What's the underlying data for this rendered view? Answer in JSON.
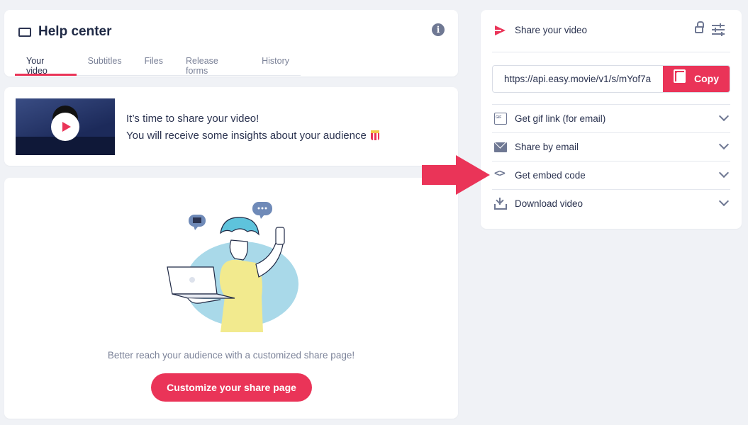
{
  "header": {
    "title": "Help center",
    "tabs": [
      {
        "label": "Your video",
        "active": true
      },
      {
        "label": "Subtitles",
        "active": false
      },
      {
        "label": "Files",
        "active": false
      },
      {
        "label": "Release forms",
        "active": false
      },
      {
        "label": "History",
        "active": false
      }
    ]
  },
  "notice": {
    "line1": "It’s time to share your video!",
    "line2": "You will receive some insights about your audience"
  },
  "customize": {
    "text": "Better reach your audience with a customized share page!",
    "button_label": "Customize your share page"
  },
  "share": {
    "title": "Share your video",
    "url": "https://api.easy.movie/v1/s/mYof7a",
    "copy_label": "Copy",
    "options": [
      {
        "label": "Get gif link (for email)",
        "icon": "gif-icon"
      },
      {
        "label": "Share by email",
        "icon": "mail-icon"
      },
      {
        "label": "Get embed code",
        "icon": "code-icon"
      },
      {
        "label": "Download video",
        "icon": "download-icon"
      }
    ]
  },
  "colors": {
    "accent": "#ea3458",
    "text": "#2b3350",
    "muted": "#7b8298",
    "background": "#f0f2f6"
  }
}
